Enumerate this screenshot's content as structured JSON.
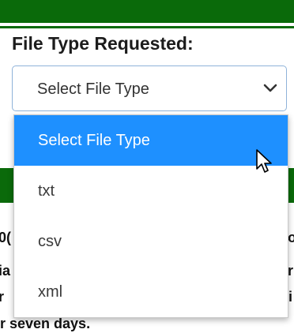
{
  "form": {
    "label": "File Type Requested:",
    "select": {
      "value": "Select File Type",
      "options": [
        {
          "label": "Select File Type",
          "selected": true
        },
        {
          "label": "txt",
          "selected": false
        },
        {
          "label": "csv",
          "selected": false
        },
        {
          "label": "xml",
          "selected": false
        }
      ]
    }
  },
  "background_text": {
    "line1_left": "0(",
    "line1_right": "o",
    "line2_left": "ia",
    "line2_right": "r",
    "line3_left": "r",
    "line3_right": "i",
    "line4": "r seven days."
  },
  "colors": {
    "header_green": "#0a6a0a",
    "selected_option": "#1e90ff",
    "select_border": "#8fb3d9"
  },
  "icons": {
    "select_chevron": "chevron-down-icon",
    "cursor": "mouse-pointer-icon"
  }
}
